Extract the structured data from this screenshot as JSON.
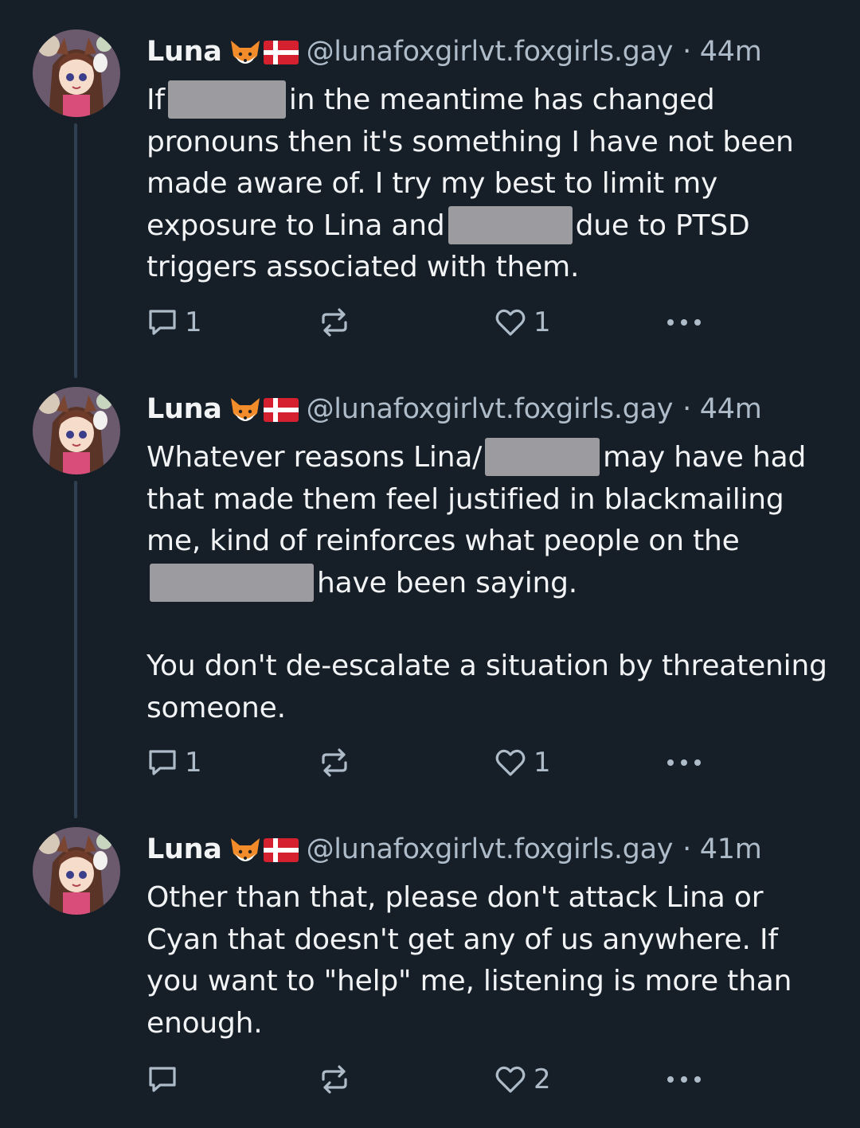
{
  "posts": [
    {
      "author": "Luna",
      "emoji": [
        "fox-emoji",
        "danish-flag-emoji"
      ],
      "handle": "@lunafoxgirlvt.foxgirls.gay",
      "time": "· 44m",
      "segments": [
        [
          "If",
          "in the meantime has changed pronouns then it's something I have not been made aware of. I try my best to limit my exposure to Lina and",
          "due to PTSD triggers associated with them."
        ]
      ],
      "reply_count": "1",
      "repost_count": "",
      "like_count": "1"
    },
    {
      "author": "Luna",
      "emoji": [
        "fox-emoji",
        "danish-flag-emoji"
      ],
      "handle": "@lunafoxgirlvt.foxgirls.gay",
      "time": "· 44m",
      "segments": [
        [
          "Whatever reasons Lina/",
          "may have had that made them feel justified in blackmailing me, kind of reinforces what people on the",
          "have been saying."
        ],
        [
          "You don't de-escalate a situation by threatening someone."
        ]
      ],
      "reply_count": "1",
      "repost_count": "",
      "like_count": "1"
    },
    {
      "author": "Luna",
      "emoji": [
        "fox-emoji",
        "danish-flag-emoji"
      ],
      "handle": "@lunafoxgirlvt.foxgirls.gay",
      "time": "· 41m",
      "segments": [
        [
          "Other than that, please don't attack Lina or Cyan that doesn't get any of us anywhere. If you want to \"help\" me, listening is more than enough."
        ]
      ],
      "reply_count": "",
      "repost_count": "",
      "like_count": "2"
    }
  ],
  "colors": {
    "background": "#161e27",
    "text": "#f1f3f5",
    "muted": "#aebbc9",
    "thread_line": "#2e4052",
    "redaction": "#9c9ca0"
  },
  "icons": [
    "reply-icon",
    "repost-icon",
    "like-icon",
    "more-icon"
  ]
}
